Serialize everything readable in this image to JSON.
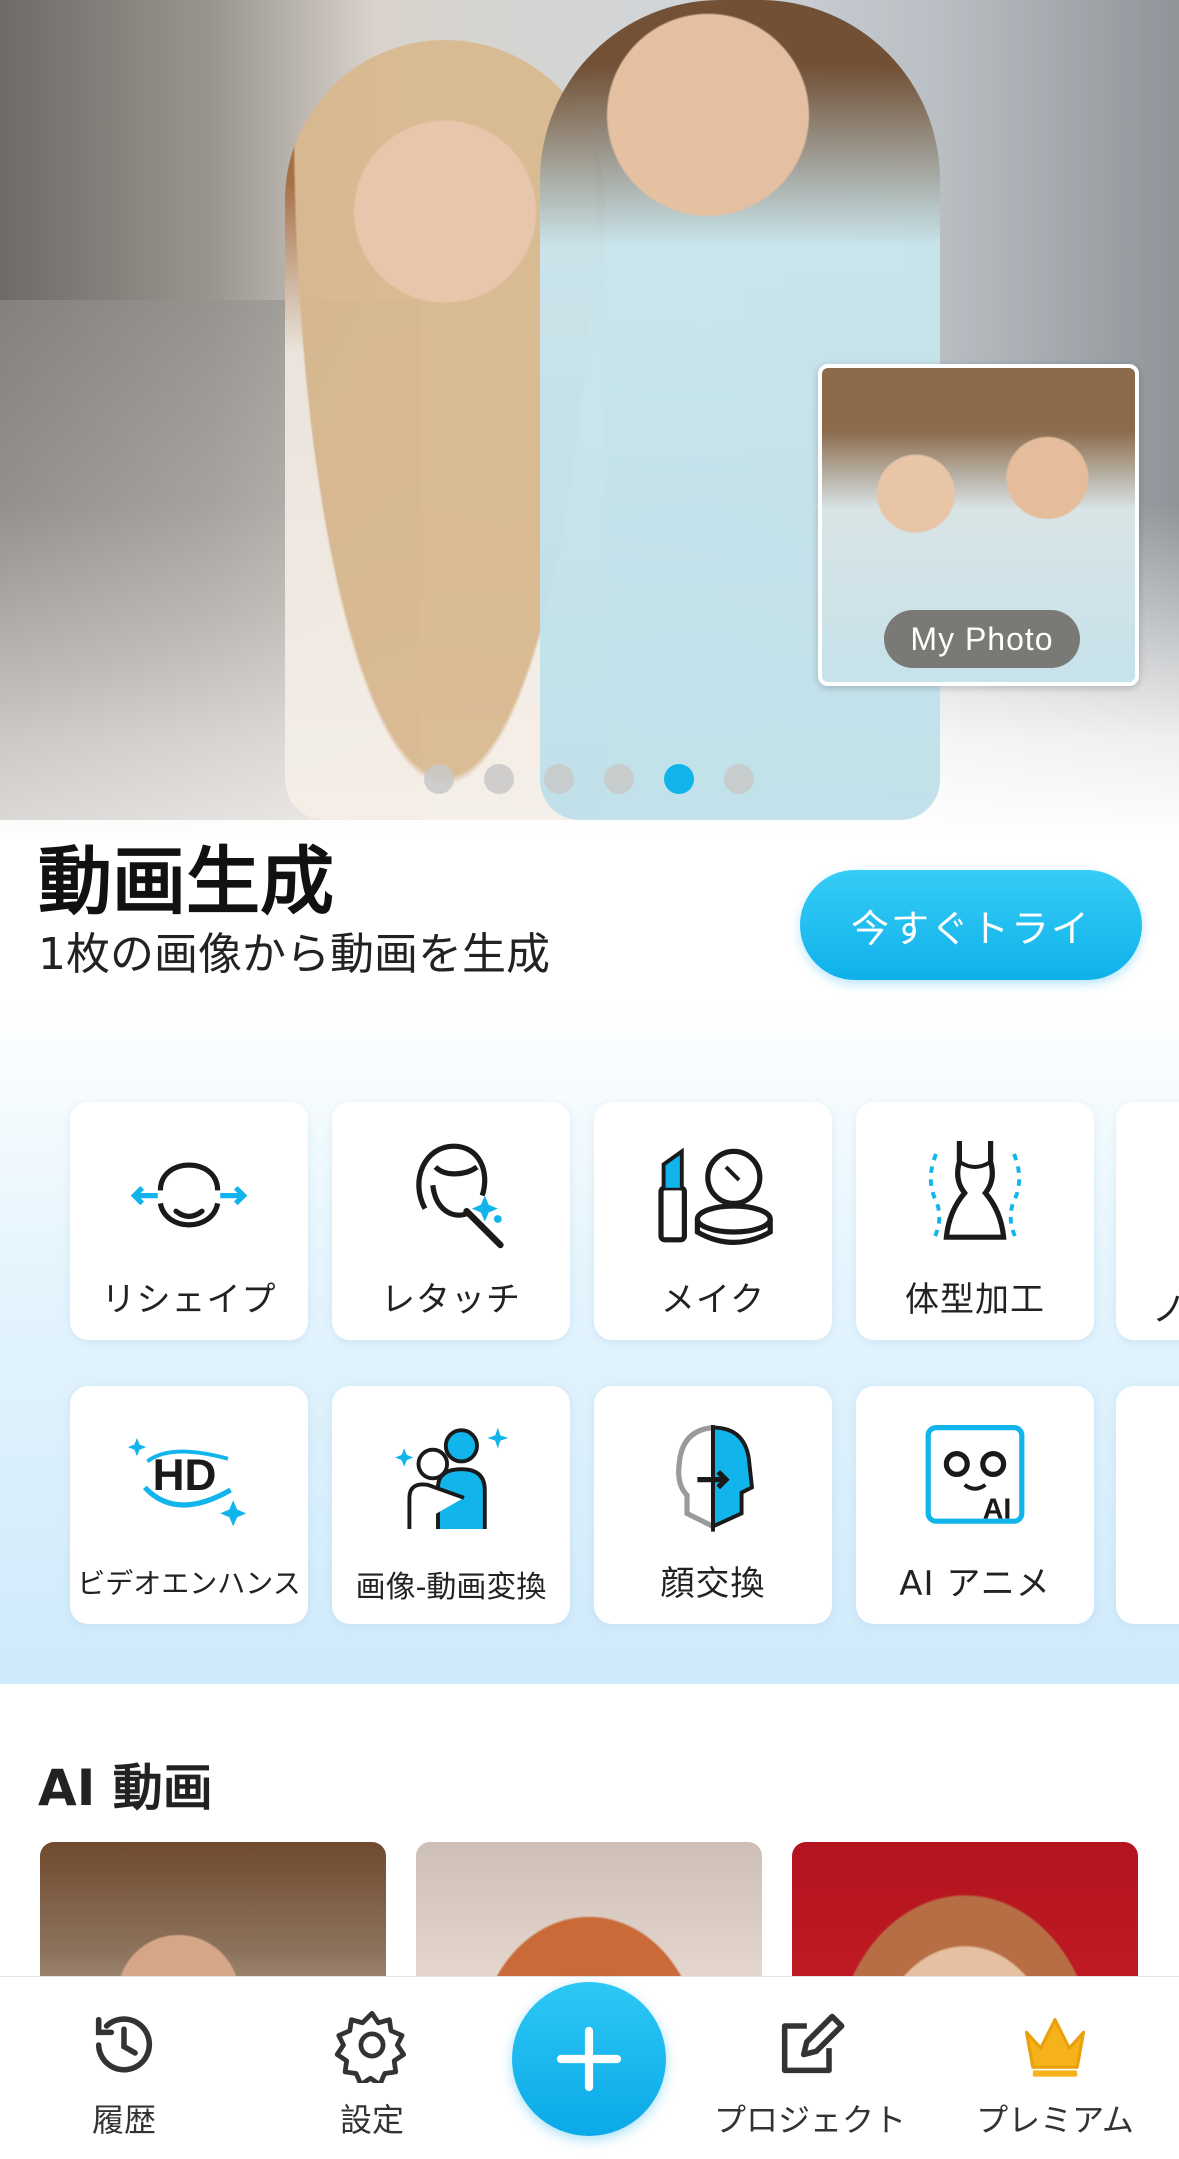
{
  "hero": {
    "inset_label": "My Photo",
    "carousel": {
      "total": 6,
      "active_index": 4
    }
  },
  "feature": {
    "title": "動画生成",
    "subtitle": "1枚の画像から動画を生成",
    "try_label": "今すぐトライ"
  },
  "tools": {
    "row1": [
      {
        "label": "リシェイプ",
        "icon": "face-reshape-icon"
      },
      {
        "label": "レタッチ",
        "icon": "retouch-wand-icon"
      },
      {
        "label": "メイク",
        "icon": "makeup-icon"
      },
      {
        "label": "体型加工",
        "icon": "body-shape-icon"
      },
      {
        "label": "ノ",
        "icon": "partial-tool-icon"
      }
    ],
    "row2": [
      {
        "label": "ビデオエンハンス",
        "icon": "hd-enhance-icon"
      },
      {
        "label": "画像-動画変換",
        "icon": "hug-animate-icon"
      },
      {
        "label": "顔交換",
        "icon": "face-swap-icon"
      },
      {
        "label": "AI アニメ",
        "icon": "ai-anime-icon"
      }
    ]
  },
  "ai_video": {
    "title": "AI 動画"
  },
  "bottom_nav": {
    "history": "履歴",
    "settings": "設定",
    "projects": "プロジェクト",
    "premium": "プレミアム"
  },
  "colors": {
    "accent": "#12b4ec",
    "premium_gold": "#f5b21b"
  }
}
